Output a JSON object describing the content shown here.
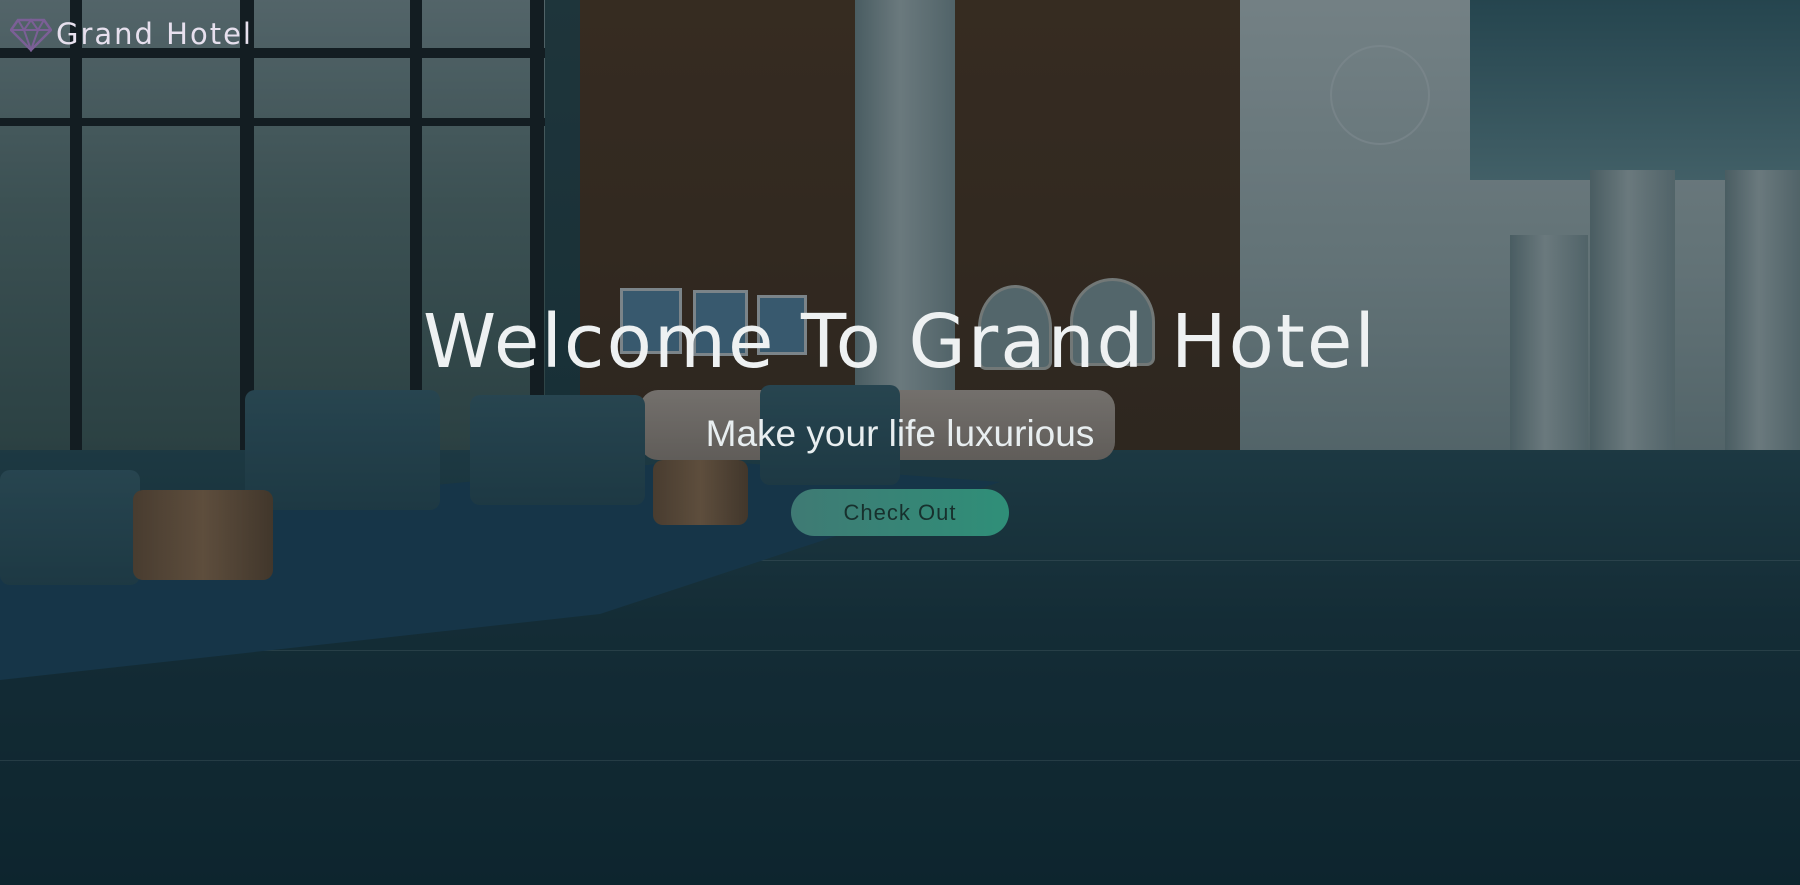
{
  "brand": {
    "name": "Grand Hotel",
    "icon": "diamond-icon",
    "icon_color": "#7b5f96"
  },
  "hero": {
    "title": "Welcome To Grand Hotel",
    "subtitle": "Make your life luxurious",
    "cta_label": "Check Out",
    "cta_color": "#2f8f78",
    "background_image": "hotel-lobby-photo"
  }
}
